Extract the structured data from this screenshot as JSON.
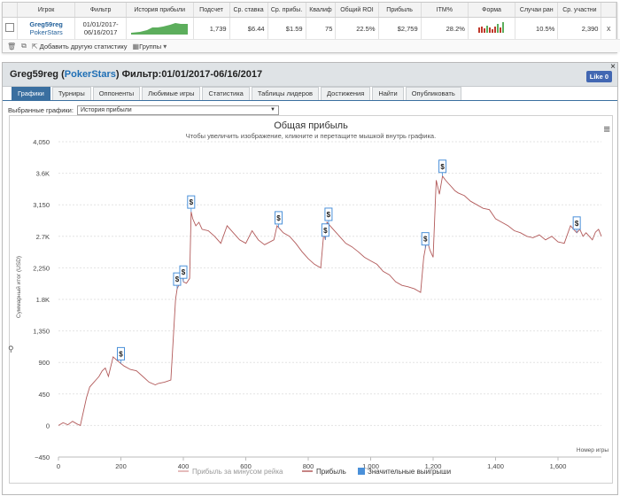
{
  "stats": {
    "headers": [
      "Игрок",
      "Фильтр",
      "История прибыли",
      "Подсчет",
      "Ср. ставка",
      "Ср. прибы.",
      "Квалиф",
      "Общий ROI",
      "Прибыль",
      "ITM%",
      "Форма",
      "Случаи ран",
      "Ср. участни"
    ],
    "player_name": "Greg59reg",
    "player_site": "PokerStars",
    "filter_line1": "01/01/2017-",
    "filter_line2": "06/16/2017",
    "count": "1,739",
    "avg_stake": "$6.44",
    "avg_profit": "$1.59",
    "qualif": "75",
    "roi": "22.5%",
    "profit": "$2,759",
    "itm": "28.2%",
    "early_cases": "10.5%",
    "avg_entrants": "2,390",
    "remove_symbol": "x",
    "toolbar": {
      "add_stat": "Добавить другую статистику",
      "groups": "Группы"
    }
  },
  "panel": {
    "player": "Greg59reg",
    "site": "PokerStars",
    "filter_label": "Фильтр:",
    "filter": "01/01/2017-06/16/2017",
    "like_label": "Like 0",
    "close": "×",
    "tabs": [
      "Графики",
      "Турниры",
      "Оппоненты",
      "Любимые игры",
      "Статистика",
      "Таблицы лидеров",
      "Достижения",
      "Найти",
      "Опубликовать"
    ],
    "selected_label": "Выбранные графики:",
    "selected_value": "История прибыли"
  },
  "colors": {
    "series": "#b25a5a",
    "marker": "#4a90d9",
    "grid": "#e3e3e3",
    "tab_active": "#3a6fa0"
  },
  "chart_data": {
    "type": "line",
    "title": "Общая прибыль",
    "subtitle": "Чтобы увеличить изображение, кликните и перетащите мышкой внутрь графика.",
    "xlabel": "Номер игры",
    "ylabel": "Суммарный итог (USD)",
    "xlim": [
      0,
      1739
    ],
    "ylim": [
      -450,
      4050
    ],
    "xticks": [
      0,
      200,
      400,
      600,
      800,
      1000,
      1200,
      1400,
      1600
    ],
    "xtick_labels": [
      "0",
      "200",
      "400",
      "600",
      "800",
      "1,000",
      "1,200",
      "1,400",
      "1,600"
    ],
    "yticks": [
      -450,
      0,
      450,
      900,
      1350,
      1800,
      2250,
      2700,
      3150,
      3600,
      4050
    ],
    "ytick_labels": [
      "−450",
      "0",
      "450",
      "900",
      "1,350",
      "1.8K",
      "2,250",
      "2.7K",
      "3,150",
      "3.6K",
      "4,050"
    ],
    "grid": true,
    "legend_position": "bottom",
    "legend": [
      "Прибыль за минусом рейка",
      "Прибыль",
      "Значительные выигрыши"
    ],
    "series": [
      {
        "name": "Прибыль",
        "x": [
          0,
          15,
          30,
          45,
          60,
          70,
          80,
          90,
          100,
          110,
          120,
          130,
          140,
          150,
          160,
          175,
          190,
          210,
          230,
          250,
          270,
          290,
          310,
          320,
          340,
          360,
          375,
          380,
          385,
          395,
          400,
          410,
          420,
          425,
          430,
          440,
          450,
          460,
          480,
          500,
          520,
          540,
          560,
          580,
          600,
          620,
          640,
          660,
          690,
          700,
          720,
          740,
          760,
          780,
          800,
          820,
          840,
          850,
          855,
          860,
          870,
          880,
          900,
          920,
          940,
          960,
          980,
          1000,
          1020,
          1040,
          1060,
          1080,
          1100,
          1120,
          1140,
          1160,
          1170,
          1180,
          1190,
          1200,
          1210,
          1220,
          1230,
          1240,
          1250,
          1260,
          1270,
          1280,
          1300,
          1320,
          1340,
          1360,
          1380,
          1400,
          1420,
          1440,
          1460,
          1480,
          1500,
          1520,
          1540,
          1560,
          1580,
          1600,
          1620,
          1640,
          1660,
          1670,
          1680,
          1690,
          1700,
          1710,
          1720,
          1730,
          1739
        ],
        "y": [
          0,
          40,
          10,
          60,
          20,
          0,
          200,
          400,
          550,
          600,
          650,
          700,
          780,
          820,
          700,
          980,
          920,
          850,
          800,
          780,
          700,
          620,
          580,
          600,
          620,
          650,
          1800,
          1950,
          2000,
          2200,
          2050,
          2030,
          2100,
          3050,
          2950,
          2850,
          2900,
          2800,
          2780,
          2700,
          2600,
          2850,
          2750,
          2650,
          2600,
          2780,
          2650,
          2580,
          2650,
          2850,
          2750,
          2700,
          2600,
          2480,
          2380,
          2300,
          2250,
          2750,
          2650,
          2900,
          2850,
          2800,
          2700,
          2600,
          2550,
          2480,
          2400,
          2350,
          2300,
          2200,
          2150,
          2050,
          2000,
          1980,
          1950,
          1900,
          2400,
          2650,
          2500,
          2400,
          3500,
          3300,
          3560,
          3500,
          3450,
          3400,
          3350,
          3320,
          3280,
          3200,
          3150,
          3100,
          3080,
          2950,
          2900,
          2850,
          2780,
          2750,
          2700,
          2680,
          2720,
          2650,
          2700,
          2620,
          2600,
          2850,
          2750,
          2800,
          2700,
          2750,
          2700,
          2650,
          2760,
          2800,
          2700
        ]
      }
    ],
    "big_wins_x": [
      200,
      380,
      400,
      425,
      705,
      855,
      865,
      1175,
      1230,
      1660
    ]
  }
}
